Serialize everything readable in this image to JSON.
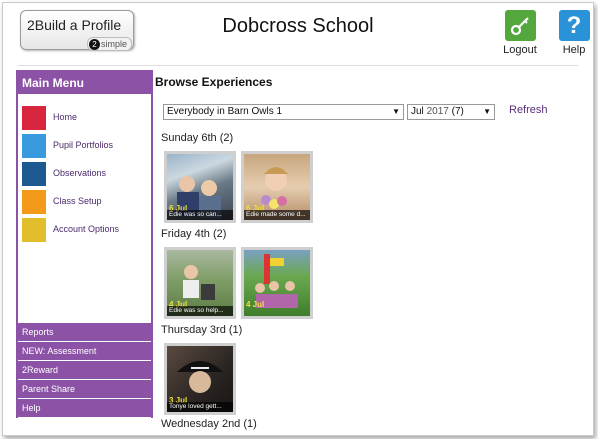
{
  "header": {
    "logo_text": "2Build a Profile",
    "logo_badge_mark": "2",
    "logo_badge_text": "simple",
    "title": "Dobcross School",
    "logout_label": "Logout",
    "help_label": "Help",
    "help_glyph": "?"
  },
  "sidebar": {
    "title": "Main Menu",
    "items": [
      {
        "label": "Home",
        "color": "#d7263d",
        "icon": "home-tile"
      },
      {
        "label": "Pupil Portfolios",
        "color": "#3a9ae0",
        "icon": "portfolios-tile"
      },
      {
        "label": "Observations",
        "color": "#1d5a8f",
        "icon": "observations-tile"
      },
      {
        "label": "Class Setup",
        "color": "#f49a1a",
        "icon": "class-setup-tile"
      },
      {
        "label": "Account Options",
        "color": "#e3be2c",
        "icon": "account-options-tile"
      }
    ],
    "sub_items": [
      "Reports",
      "NEW: Assessment",
      "2Reward",
      "Parent Share",
      "Help"
    ]
  },
  "main": {
    "title": "Browse Experiences",
    "group_select": "Everybody in Barn Owls 1",
    "month_select": {
      "month": "Jul",
      "year": "2017",
      "count": "(7)"
    },
    "refresh_label": "Refresh",
    "days": [
      {
        "label": "Sunday 6th (2)"
      },
      {
        "label": "Friday 4th (2)"
      },
      {
        "label": "Thursday 3rd (1)"
      },
      {
        "label": "Wednesday 2nd (1)"
      }
    ],
    "thumbnails": [
      {
        "date": "6 Jul",
        "caption": "Edie was so can..."
      },
      {
        "date": "6 Jul",
        "caption": "Edie made some d..."
      },
      {
        "date": "4 Jul",
        "caption": "Edie was so help..."
      },
      {
        "date": "4 Jul",
        "caption": ""
      },
      {
        "date": "3 Jul",
        "caption": "Tonye loved gett..."
      }
    ]
  },
  "colors": {
    "menu_purple": "#8b52a6",
    "logout_green": "#53a73c",
    "help_blue": "#2a93d8",
    "caption_date_yellow": "#f0e040"
  }
}
